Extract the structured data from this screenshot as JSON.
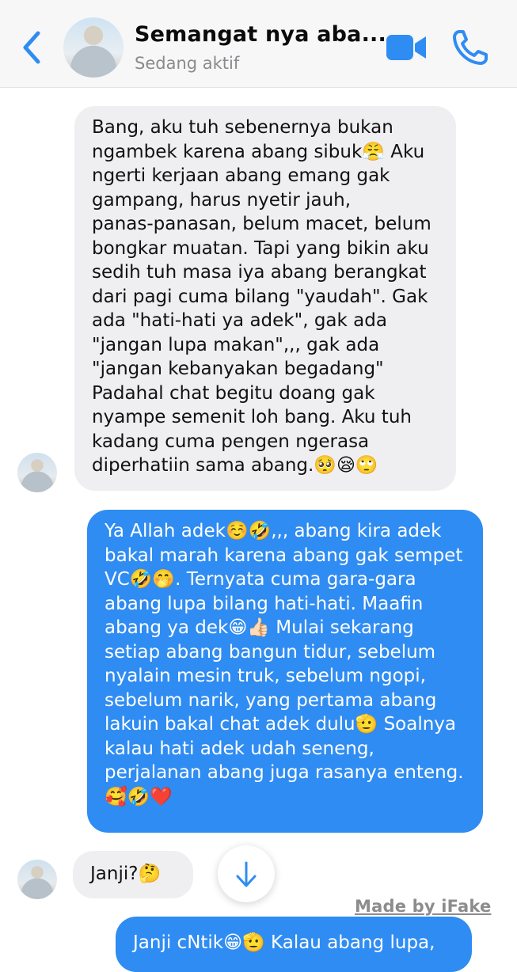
{
  "header": {
    "title": "Semangat nya aba...",
    "status": "Sedang aktif",
    "back_icon": "chevron-left-icon",
    "video_icon": "video-camera-icon",
    "call_icon": "phone-icon",
    "accent": "#2f8cf2"
  },
  "messages": [
    {
      "direction": "incoming",
      "text": "Bang, aku tuh sebenernya bukan\nngambek karena abang sibuk😤 Aku\nngerti kerjaan abang emang gak\ngampang, harus nyetir jauh,\npanas-panasan, belum macet, belum\nbongkar muatan. Tapi yang bikin aku\nsedih tuh masa iya abang berangkat\ndari pagi cuma bilang \"yaudah\". Gak\nada \"hati-hati ya adek\", gak ada\n\"jangan lupa makan\",,, gak ada\n\"jangan kebanyakan begadang\"\nPadahal chat begitu doang gak\nnyampe semenit loh bang. Aku tuh\nkadang cuma pengen ngerasa\ndiperhatiin sama abang.🥺😪🙄"
    },
    {
      "direction": "outgoing",
      "text": "Ya Allah adek☺️🤣,,, abang kira adek\nbakal marah karena abang gak sempet\nVC🤣🤭. Ternyata cuma gara-gara\nabang lupa bilang hati-hati. Maafin\nabang ya dek😁👍🏻 Mulai sekarang\nsetiap abang bangun tidur, sebelum\nnyalain mesin truk, sebelum ngopi,\nsebelum narik, yang pertama abang\nlakuin bakal chat adek dulu🫡 Soalnya\nkalau hati adek udah seneng,\nperjalanan abang juga rasanya enteng.\n🥰🤣❤️"
    },
    {
      "direction": "incoming",
      "text": "Janji?🤔"
    },
    {
      "direction": "outgoing",
      "text": "Janji cNtik😁🫡 Kalau abang lupa,"
    }
  ],
  "scroll_down_icon": "arrow-down-icon",
  "watermark": "Made by iFake",
  "colors": {
    "incoming_bubble": "#efeff2",
    "outgoing_bubble": "#2f8cf2",
    "header_bg": "#f7f7f8"
  }
}
